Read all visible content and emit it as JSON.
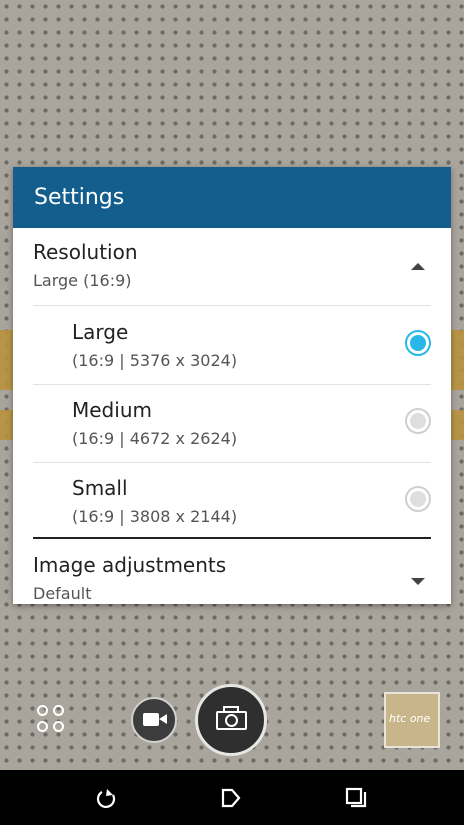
{
  "dialog": {
    "title": "Settings",
    "resolution": {
      "title": "Resolution",
      "value": "Large (16:9)",
      "options": [
        {
          "label": "Large",
          "detail": "(16:9 | 5376 x 3024)",
          "selected": true
        },
        {
          "label": "Medium",
          "detail": "(16:9 | 4672 x 2624)",
          "selected": false
        },
        {
          "label": "Small",
          "detail": "(16:9 | 3808 x 2144)",
          "selected": false
        }
      ]
    },
    "image_adjustments": {
      "title": "Image adjustments",
      "value": "Default"
    }
  },
  "camera": {
    "thumbnail_logo": "htc one",
    "icons": {
      "apps": "apps-grid-icon",
      "video": "video-camera-icon",
      "shutter": "camera-icon"
    }
  },
  "navbar": {
    "icons": [
      "back-icon",
      "home-icon",
      "recent-apps-icon"
    ]
  },
  "colors": {
    "header": "#135e8c",
    "accent": "#29b6e8"
  }
}
